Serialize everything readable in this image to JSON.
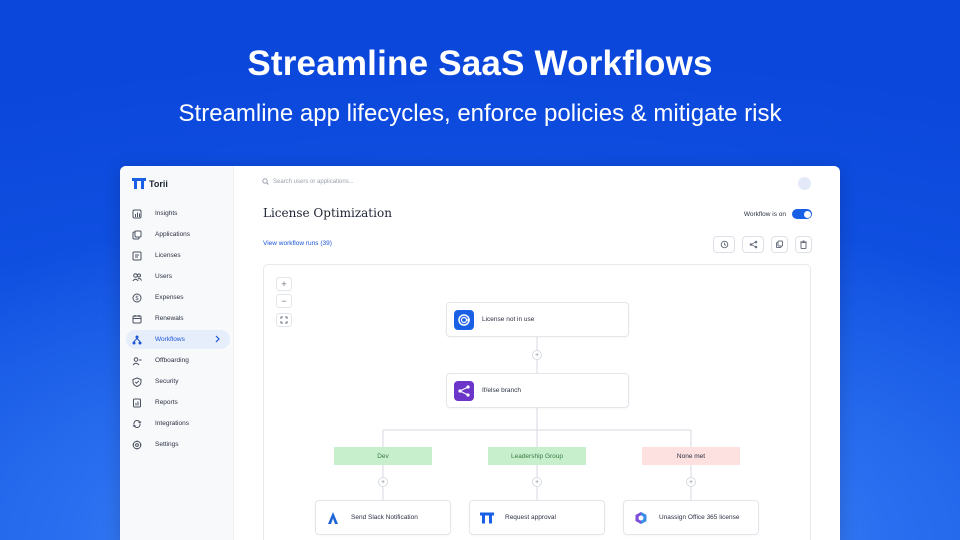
{
  "hero": {
    "title": "Streamline SaaS Workflows",
    "subtitle": "Streamline app lifecycles, enforce policies & mitigate risk"
  },
  "app": {
    "logo_text": "Torii",
    "sidebar": {
      "items": [
        {
          "label": "Insights",
          "icon": "bar-chart-icon"
        },
        {
          "label": "Applications",
          "icon": "applications-icon"
        },
        {
          "label": "Licenses",
          "icon": "license-icon"
        },
        {
          "label": "Users",
          "icon": "users-icon"
        },
        {
          "label": "Expenses",
          "icon": "dollar-icon"
        },
        {
          "label": "Renewals",
          "icon": "calendar-icon"
        },
        {
          "label": "Workflows",
          "icon": "workflow-icon",
          "active": true
        },
        {
          "label": "Offboarding",
          "icon": "user-remove-icon"
        },
        {
          "label": "Security",
          "icon": "shield-icon"
        },
        {
          "label": "Reports",
          "icon": "report-icon"
        },
        {
          "label": "Integrations",
          "icon": "integrations-icon"
        },
        {
          "label": "Settings",
          "icon": "gear-icon"
        }
      ]
    },
    "search": {
      "placeholder": "Search users or applications..."
    },
    "page_title": "License Optimization",
    "workflow_toggle": {
      "label": "Workflow is on",
      "on": true
    },
    "runs_link": "View workflow runs (39)",
    "actions": [
      "history-icon",
      "share-icon",
      "copy-icon",
      "trash-icon"
    ],
    "zoom": {
      "in": "+",
      "out": "−"
    },
    "workflow": {
      "trigger": {
        "label": "License not in use",
        "icon": "license-trigger-icon"
      },
      "branch_node": {
        "label": "If/else branch",
        "icon": "branch-icon"
      },
      "branches": [
        {
          "label": "Dev",
          "bg": "#c8efcc",
          "fg": "#3b7a44"
        },
        {
          "label": "Leadership Group",
          "bg": "#c8efcc",
          "fg": "#3b7a44"
        },
        {
          "label": "None met",
          "bg": "#fde0e0",
          "fg": "#2b3142"
        }
      ],
      "actions": [
        {
          "label": "Send Slack Notification",
          "icon": "atlassian-icon"
        },
        {
          "label": "Request approval",
          "icon": "torii-icon"
        },
        {
          "label": "Unassign Office 365 license",
          "icon": "office365-icon"
        }
      ]
    }
  },
  "colors": {
    "brand": "#1a60e6",
    "accent_link": "#1a55d6",
    "branch_icon_bg": "#6b35c9",
    "trigger_icon_bg": "#1a60e6"
  }
}
